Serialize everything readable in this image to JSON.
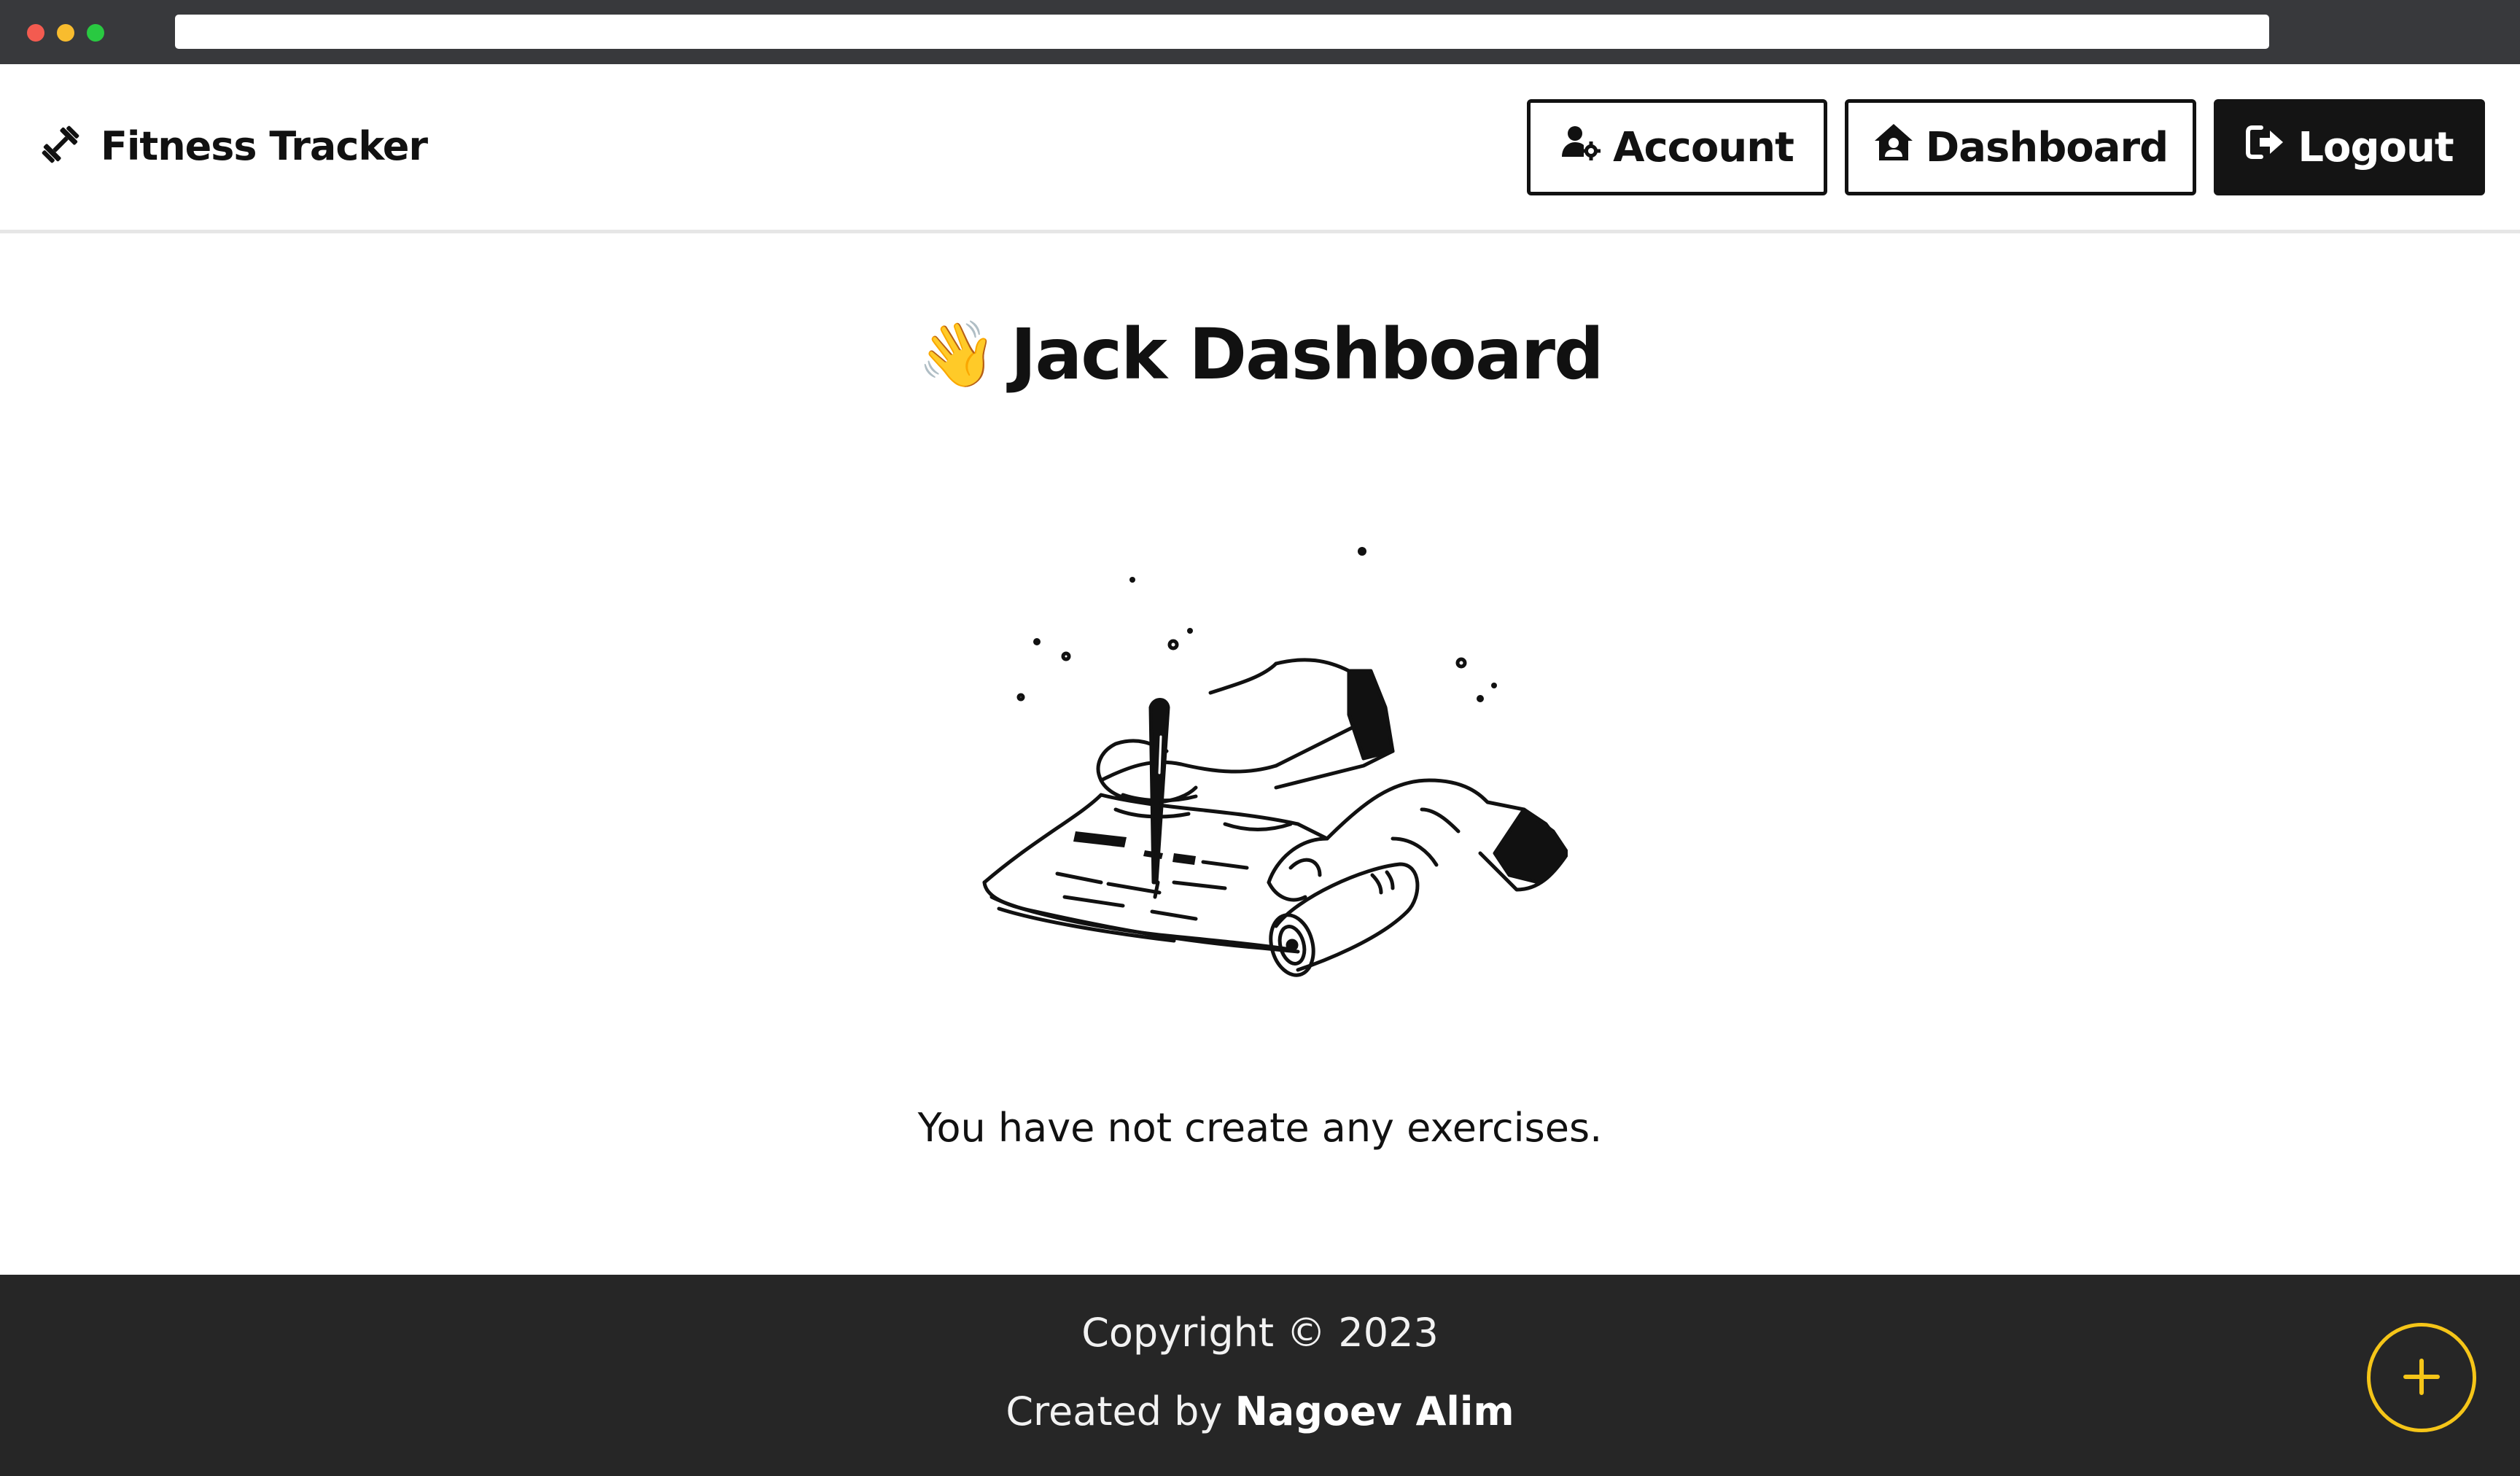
{
  "navbar": {
    "brand": "Fitness Tracker",
    "brand_icon": "dumbbell-icon",
    "buttons": {
      "account": "Account",
      "dashboard": "Dashboard",
      "logout": "Logout"
    }
  },
  "main": {
    "title_emoji": "👋",
    "title": "Jack Dashboard",
    "illustration": "empty-state-illustration",
    "empty_message": "You have not create any exercises."
  },
  "footer": {
    "copyright": "Copyright © 2023",
    "created_by_prefix": "Created by",
    "author": "Nagoev Alim"
  },
  "fab": {
    "icon": "plus-icon",
    "accent_color": "#f5c518"
  },
  "colors": {
    "dark": "#141414",
    "footer_bg": "#262626",
    "chrome_bg": "#38393c"
  }
}
